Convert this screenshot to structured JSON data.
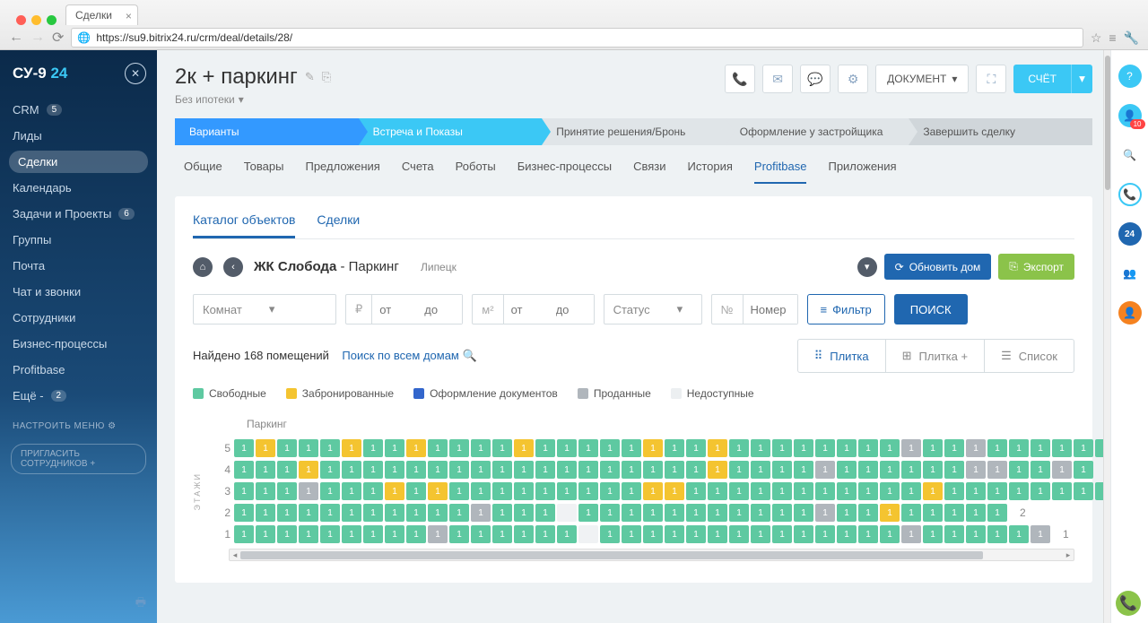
{
  "browser": {
    "tab_title": "Сделки",
    "url": "https://su9.bitrix24.ru/crm/deal/details/28/"
  },
  "logo": {
    "part1": "СУ-9 ",
    "part2": "24"
  },
  "sidebar": {
    "items": [
      {
        "label": "CRM",
        "badge": "5"
      },
      {
        "label": "Лиды"
      },
      {
        "label": "Сделки",
        "active": true
      },
      {
        "label": "Календарь"
      },
      {
        "label": "Задачи и Проекты",
        "badge": "6"
      },
      {
        "label": "Группы"
      },
      {
        "label": "Почта"
      },
      {
        "label": "Чат и звонки"
      },
      {
        "label": "Сотрудники"
      },
      {
        "label": "Бизнес-процессы"
      },
      {
        "label": "Profitbase"
      },
      {
        "label": "Ещё -",
        "badge": "2"
      }
    ],
    "settings_label": "НАСТРОИТЬ МЕНЮ",
    "invite_label": "ПРИГЛАСИТЬ СОТРУДНИКОВ  +"
  },
  "deal": {
    "title": "2к + паркинг",
    "subtitle": "Без ипотеки",
    "actions": {
      "document": "ДОКУМЕНТ",
      "account": "СЧЁТ"
    }
  },
  "pipeline": [
    {
      "label": "Варианты",
      "cls": "blue"
    },
    {
      "label": "Встреча и Показы",
      "cls": "cyan"
    },
    {
      "label": "Принятие решения/Бронь",
      "cls": "gray"
    },
    {
      "label": "Оформление у застройщика",
      "cls": "gray"
    },
    {
      "label": "Завершить сделку",
      "cls": "dark"
    }
  ],
  "tabs": [
    "Общие",
    "Товары",
    "Предложения",
    "Счета",
    "Роботы",
    "Бизнес-процессы",
    "Связи",
    "История",
    "Profitbase",
    "Приложения"
  ],
  "tabs_active": "Profitbase",
  "panel_tabs": {
    "catalog": "Каталог объектов",
    "deals": "Сделки"
  },
  "breadcrumb": {
    "name_bold": "ЖК Слобода",
    "name_rest": " - Паркинг",
    "city": "Липецк",
    "refresh": "Обновить дом",
    "export": "Экспорт"
  },
  "filters": {
    "rooms": "Комнат",
    "price_sym": "₽",
    "from": "от",
    "to": "до",
    "area_sym": "м²",
    "status": "Статус",
    "num_sym": "№",
    "num_ph": "Номер",
    "filter": "Фильтр",
    "search": "ПОИСК"
  },
  "results": {
    "found": "Найдено 168 помещений",
    "link": "Поиск по всем домам"
  },
  "views": {
    "tile": "Плитка",
    "tile_plus": "Плитка +",
    "list": "Список"
  },
  "legend": [
    {
      "label": "Свободные",
      "color": "#5ec9a1"
    },
    {
      "label": "Забронированные",
      "color": "#f4c430"
    },
    {
      "label": "Оформление документов",
      "color": "#3366cc"
    },
    {
      "label": "Проданные",
      "color": "#b0b6bc"
    },
    {
      "label": "Недоступные",
      "color": "#eceff1"
    }
  ],
  "grid": {
    "title": "Паркинг",
    "y_label": "ЭТАЖИ",
    "floors": [
      {
        "n": 5,
        "cells": "gygggyggyggggygggggyggyggggggggrggrgggggggg"
      },
      {
        "n": 4,
        "cells": "gggyggggggggggggggggggyggggrggggggrrggrg"
      },
      {
        "n": 3,
        "cells": "gggrgggygygggggggggyygggggggggggyggggggggg"
      },
      {
        "n": 2,
        "cells": "gggggggggggrgggegggggggggggrggyggggg"
      },
      {
        "n": 1,
        "cells": "gggggggggrggggggeggggggggggggggrgggggr"
      }
    ]
  }
}
